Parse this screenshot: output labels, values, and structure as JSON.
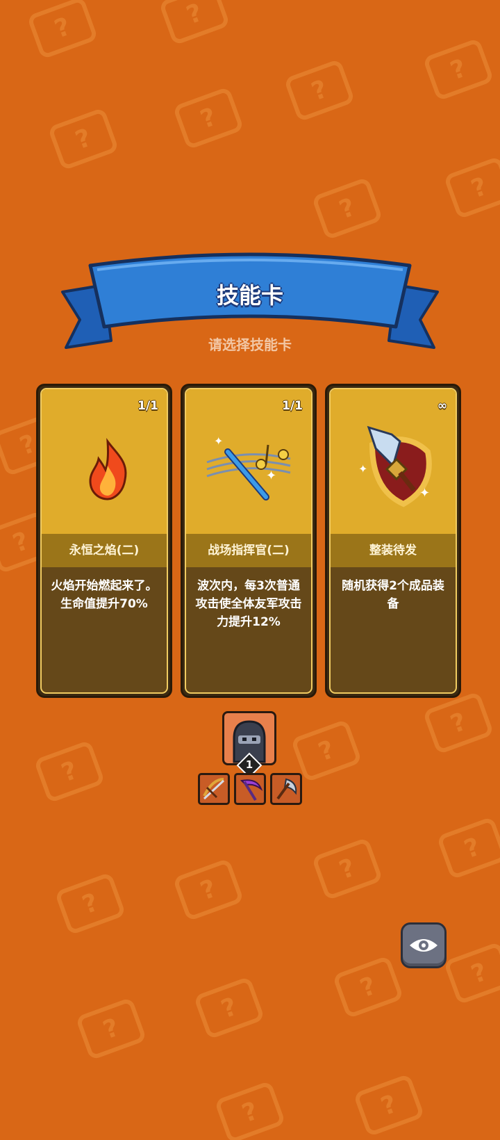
{
  "header": {
    "title": "技能卡",
    "subtitle": "请选择技能卡"
  },
  "cards": [
    {
      "count": "1/1",
      "name": "永恒之焰(二)",
      "description": "火焰开始燃起来了。生命值提升70%",
      "icon": "flame-icon"
    },
    {
      "count": "1/1",
      "name": "战场指挥官(二)",
      "description": "波次内，每3次普通攻击使全体友军攻击力提升12%",
      "icon": "baton-music-icon"
    },
    {
      "count": "∞",
      "name": "整装待发",
      "description": "随机获得2个成品装备",
      "icon": "sword-shield-icon"
    }
  ],
  "hero": {
    "level": "1",
    "avatar": "ninja-avatar",
    "weapons": [
      "crossbow-icon",
      "scythe-icon",
      "axe-icon"
    ]
  },
  "controls": {
    "view_button_icon": "eye-icon"
  },
  "colors": {
    "background": "#d96716",
    "ribbon": "#2f7fd6",
    "card_top": "#e0ac2b",
    "card_band": "#9b7519",
    "card_body": "#654819"
  }
}
